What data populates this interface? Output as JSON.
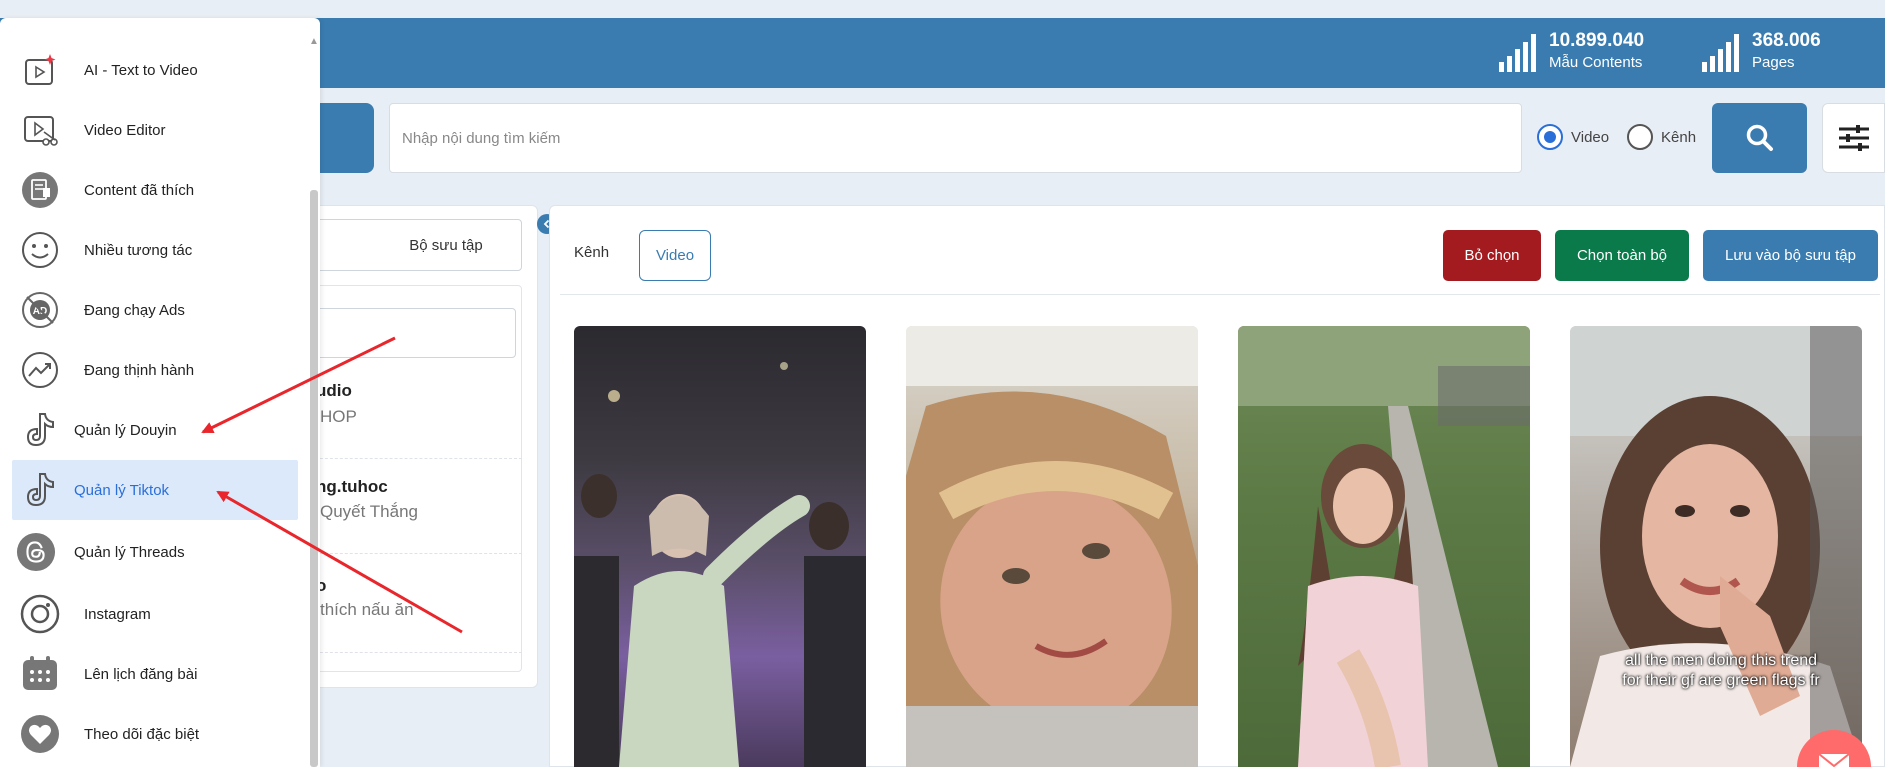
{
  "header": {
    "stats": [
      {
        "value": "10.899.040",
        "label": "Mẫu Contents"
      },
      {
        "value": "368.006",
        "label": "Pages"
      }
    ]
  },
  "search": {
    "placeholder": "Nhập nội dung tìm kiếm",
    "radio_options": [
      {
        "label": "Video",
        "selected": true
      },
      {
        "label": "Kênh",
        "selected": false
      }
    ]
  },
  "left_panel": {
    "collection_tab": "Bộ sưu tập",
    "items": [
      {
        "title": "udio",
        "subtitle": "HOP"
      },
      {
        "title": "ng.tuhoc",
        "subtitle": "Quyết Thắng"
      },
      {
        "title": "o",
        "subtitle": "thích nấu ăn"
      }
    ]
  },
  "main": {
    "tabs": [
      {
        "label": "Kênh",
        "active": false
      },
      {
        "label": "Video",
        "active": true
      }
    ],
    "actions": {
      "deselect": "Bỏ chọn",
      "select_all": "Chọn toàn bộ",
      "save_collection": "Lưu vào bộ sưu tập"
    },
    "thumbnails": [
      {
        "caption": ""
      },
      {
        "caption": ""
      },
      {
        "caption": ""
      },
      {
        "caption": "all the men doing this trend for their gf are green flags fr"
      }
    ]
  },
  "sidebar": {
    "items": [
      {
        "label": "AI - Text to Video",
        "icon": "ai-video-icon",
        "active": false
      },
      {
        "label": "Video Editor",
        "icon": "video-editor-icon",
        "active": false
      },
      {
        "label": "Content đã thích",
        "icon": "liked-content-icon",
        "active": false
      },
      {
        "label": "Nhiều tương tác",
        "icon": "smile-icon",
        "active": false
      },
      {
        "label": "Đang chạy Ads",
        "icon": "ads-icon",
        "active": false
      },
      {
        "label": "Đang thịnh hành",
        "icon": "trending-icon",
        "active": false
      },
      {
        "label": "Quản lý Douyin",
        "icon": "douyin-icon",
        "active": false
      },
      {
        "label": "Quản lý Tiktok",
        "icon": "tiktok-icon",
        "active": true
      },
      {
        "label": "Quản lý Threads",
        "icon": "threads-icon",
        "active": false
      },
      {
        "label": "Instagram",
        "icon": "instagram-icon",
        "active": false
      },
      {
        "label": "Lên lịch đăng bài",
        "icon": "calendar-icon",
        "active": false
      },
      {
        "label": "Theo dõi đặc biệt",
        "icon": "heart-icon",
        "active": false
      }
    ]
  },
  "colors": {
    "primary": "#3a7cb0",
    "deselect": "#a31b1f",
    "select_all": "#0a7a4a",
    "active_item_bg": "#dbe9fb",
    "annotation_arrow": "#e8262b"
  }
}
